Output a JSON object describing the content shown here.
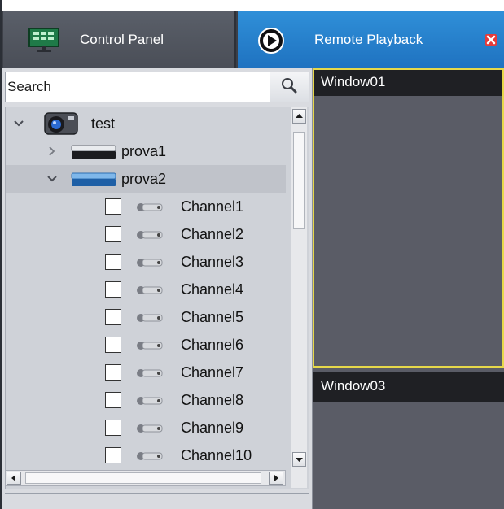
{
  "tabs": {
    "control_panel": {
      "label": "Control Panel",
      "icon": "monitor-grid-icon"
    },
    "remote_playback": {
      "label": "Remote Playback",
      "icon": "playback-icon",
      "close_icon": "close-icon"
    }
  },
  "search": {
    "placeholder": "Search",
    "icon": "search-icon"
  },
  "tree": {
    "root": {
      "label": "test",
      "icon": "camera-root-icon",
      "expanded": true
    },
    "devices": [
      {
        "label": "prova1",
        "icon": "dvr-icon",
        "expanded": false
      },
      {
        "label": "prova2",
        "icon": "dvr-icon",
        "expanded": true,
        "selected": true
      }
    ],
    "channels": [
      {
        "label": "Channel1",
        "checked": false
      },
      {
        "label": "Channel2",
        "checked": false
      },
      {
        "label": "Channel3",
        "checked": false
      },
      {
        "label": "Channel4",
        "checked": false
      },
      {
        "label": "Channel5",
        "checked": false
      },
      {
        "label": "Channel6",
        "checked": false
      },
      {
        "label": "Channel7",
        "checked": false
      },
      {
        "label": "Channel8",
        "checked": false
      },
      {
        "label": "Channel9",
        "checked": false
      },
      {
        "label": "Channel10",
        "checked": false
      }
    ]
  },
  "windows": [
    {
      "title": "Window01",
      "active": true
    },
    {
      "title": "Window03",
      "active": false
    }
  ],
  "colors": {
    "tab_active": "#1f72c0",
    "active_window_border": "#e6d84a",
    "video_bg": "#5a5c66"
  }
}
